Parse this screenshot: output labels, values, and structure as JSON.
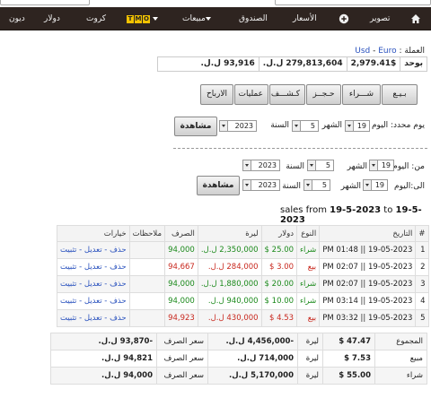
{
  "nav": {
    "items": [
      {
        "label": "تصوير"
      },
      {
        "label": "الأسعار"
      },
      {
        "label": "الصندوق"
      },
      {
        "label": "مبيعات"
      },
      {
        "label": "كروت"
      },
      {
        "label": "دولار"
      },
      {
        "label": "ديون"
      }
    ],
    "omt_letters": [
      "T",
      "M",
      "O"
    ]
  },
  "currency": {
    "label": "العملة :",
    "usd": "Usd",
    "sep": " - ",
    "euro": "Euro"
  },
  "rates": [
    "بوحد",
    "2,979.41$",
    "279,813,604 ل.ل.",
    "93,916 ل.ل."
  ],
  "tabs": [
    "بـيـع",
    "شـــراء",
    "حـجــز",
    "كـشـــف",
    "عمليات",
    "الارباح"
  ],
  "filter_single": {
    "label_day": "يوم محدد: اليوم",
    "day": "19",
    "label_month": "الشهر",
    "month": "5",
    "label_year": "السنة",
    "year": "2023",
    "button": "مشاهدة"
  },
  "filter_range": {
    "from_label": "من: اليوم",
    "to_label": "الى:اليوم",
    "label_month": "الشهر",
    "label_year": "السنة",
    "from": {
      "day": "19",
      "month": "5",
      "year": "2023"
    },
    "to": {
      "day": "19",
      "month": "5",
      "year": "2023"
    },
    "button": "مشاهدة"
  },
  "heading": {
    "prefix": "sales from ",
    "from": "19-5-2023",
    "mid": " to ",
    "to": "19-5-2023"
  },
  "table": {
    "headers": [
      "#",
      "التاريخ",
      "النوع",
      "دولار",
      "ليرة",
      "الصرف",
      "ملاحظات",
      "خيارات"
    ],
    "rows": [
      {
        "n": "1",
        "date": "19-05-2023 || 01:48 PM",
        "type": "شراء",
        "usd": "25.00 $",
        "lbp": "2,350,000 ل.ل.",
        "rate": "94,000",
        "notes": "",
        "actions": "حذف - تعديل - تثبيت",
        "kind": "buy"
      },
      {
        "n": "2",
        "date": "19-05-2023 || 02:07 PM",
        "type": "بيع",
        "usd": "3.00 $",
        "lbp": "284,000 ل.ل.",
        "rate": "94,667",
        "notes": "",
        "actions": "حذف - تعديل - تثبيت",
        "kind": "sell"
      },
      {
        "n": "3",
        "date": "19-05-2023 || 02:07 PM",
        "type": "شراء",
        "usd": "20.00 $",
        "lbp": "1,880,000 ل.ل.",
        "rate": "94,000",
        "notes": "",
        "actions": "حذف - تعديل - تثبيت",
        "kind": "buy"
      },
      {
        "n": "4",
        "date": "19-05-2023 || 03:14 PM",
        "type": "شراء",
        "usd": "10.00 $",
        "lbp": "940,000 ل.ل.",
        "rate": "94,000",
        "notes": "",
        "actions": "حذف - تعديل - تثبيت",
        "kind": "buy"
      },
      {
        "n": "5",
        "date": "19-05-2023 || 03:32 PM",
        "type": "بيع",
        "usd": "4.53 $",
        "lbp": "430,000 ل.ل.",
        "rate": "94,923",
        "notes": "",
        "actions": "حذف - تعديل - تثبيت",
        "kind": "sell"
      }
    ]
  },
  "summary": [
    {
      "label": "المجموع",
      "usd": "47.47 $",
      "lira_label": "ليرة",
      "lira": "-4,456,000 ل.ل.",
      "rate_label": "سعر الصرف",
      "rate": "-93,870 ل.ل."
    },
    {
      "label": "مبيع",
      "usd": "7.53 $",
      "lira_label": "ليرة",
      "lira": "714,000 ل.ل.",
      "rate_label": "سعر الصرف",
      "rate": "94,821 ل.ل."
    },
    {
      "label": "شراء",
      "usd": "55.00 $",
      "lira_label": "ليرة",
      "lira": "5,170,000 ل.ل.",
      "rate_label": "سعر الصرف",
      "rate": "94,000 ل.ل."
    }
  ]
}
